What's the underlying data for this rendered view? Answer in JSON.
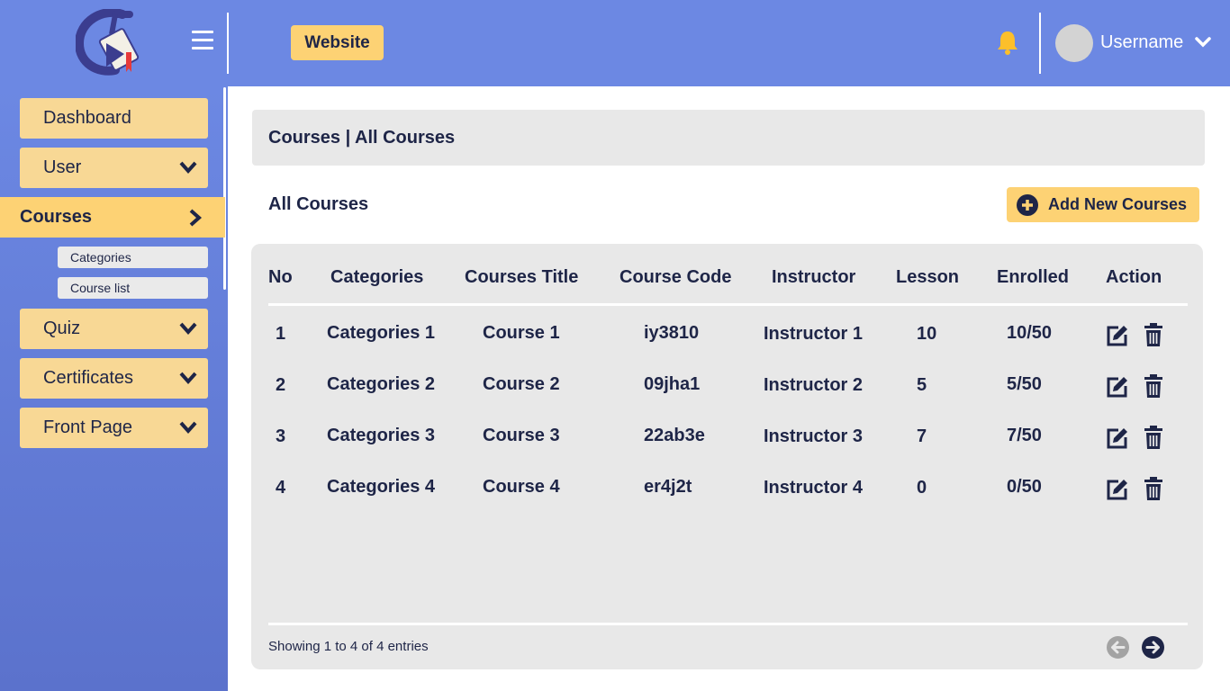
{
  "header": {
    "website_label": "Website",
    "username": "Username"
  },
  "colors": {
    "header_bg": "#6c88e3",
    "accent_yellow": "#fdd274",
    "nav_item_bg": "#f8d895",
    "text_dark": "#1e2547",
    "panel_bg": "#e8e8e8",
    "bell": "#fcbf2b"
  },
  "sidebar": {
    "items": [
      {
        "label": "Dashboard",
        "icon": null
      },
      {
        "label": "User",
        "icon": "chevron-down-icon"
      },
      {
        "label": "Courses",
        "icon": "chevron-right-icon",
        "active": true
      },
      {
        "label": "Quiz",
        "icon": "chevron-down-icon"
      },
      {
        "label": "Certificates",
        "icon": "chevron-down-icon"
      },
      {
        "label": "Front Page",
        "icon": "chevron-down-icon"
      }
    ],
    "sub_items": [
      "Categories",
      "Course list"
    ]
  },
  "breadcrumb": "Courses | All Courses",
  "section_title": "All Courses",
  "add_button_label": "Add New Courses",
  "table": {
    "columns": [
      "No",
      "Categories",
      "Courses Title",
      "Course Code",
      "Instructor",
      "Lesson",
      "Enrolled",
      "Action"
    ],
    "rows": [
      [
        "1",
        "Categories 1",
        "Course 1",
        "iy3810",
        "Instructor 1",
        "10",
        "10/50"
      ],
      [
        "2",
        "Categories 2",
        "Course 2",
        "09jha1",
        "Instructor 2",
        "5",
        "5/50"
      ],
      [
        "3",
        "Categories 3",
        "Course 3",
        "22ab3e",
        "Instructor 3",
        "7",
        "7/50"
      ],
      [
        "4",
        "Categories 4",
        "Course 4",
        "er4j2t",
        "Instructor 4",
        "0",
        "0/50"
      ]
    ]
  },
  "footer": {
    "showing": "Showing 1 to 4 of 4 entries"
  }
}
